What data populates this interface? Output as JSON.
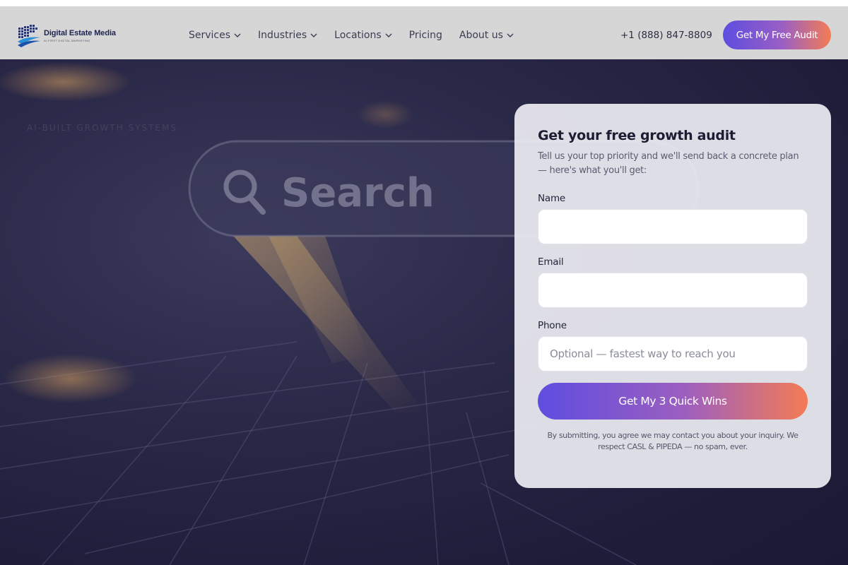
{
  "brand": {
    "name": "Digital Estate Media",
    "tagline": "AI-FIRST DIGITAL MARKETING"
  },
  "nav": {
    "items": [
      {
        "label": "Services",
        "has_dropdown": true
      },
      {
        "label": "Industries",
        "has_dropdown": true
      },
      {
        "label": "Locations",
        "has_dropdown": true
      },
      {
        "label": "Pricing",
        "has_dropdown": false
      },
      {
        "label": "About us",
        "has_dropdown": true
      }
    ],
    "phone": "+1 (888) 847-8809",
    "cta_label": "Get My Free Audit"
  },
  "hero": {
    "eyebrow": "AI-BUILT GROWTH SYSTEMS",
    "background_text": "Search"
  },
  "form": {
    "title": "Get your free growth audit",
    "subtitle": "Tell us your top priority and we'll send back a concrete plan — here's what you'll get:",
    "name_label": "Name",
    "name_value": "",
    "email_label": "Email",
    "email_value": "",
    "phone_label": "Phone",
    "phone_placeholder": "Optional — fastest way to reach you",
    "submit_label": "Get My 3 Quick Wins",
    "disclaimer": "By submitting, you agree we may contact you about your inquiry. We respect CASL & PIPEDA — no spam, ever."
  },
  "colors": {
    "gradient_start": "#5e4de0",
    "gradient_end": "#f47c54",
    "header_bg": "#d7d6d6",
    "hero_bg": "#23213f"
  }
}
